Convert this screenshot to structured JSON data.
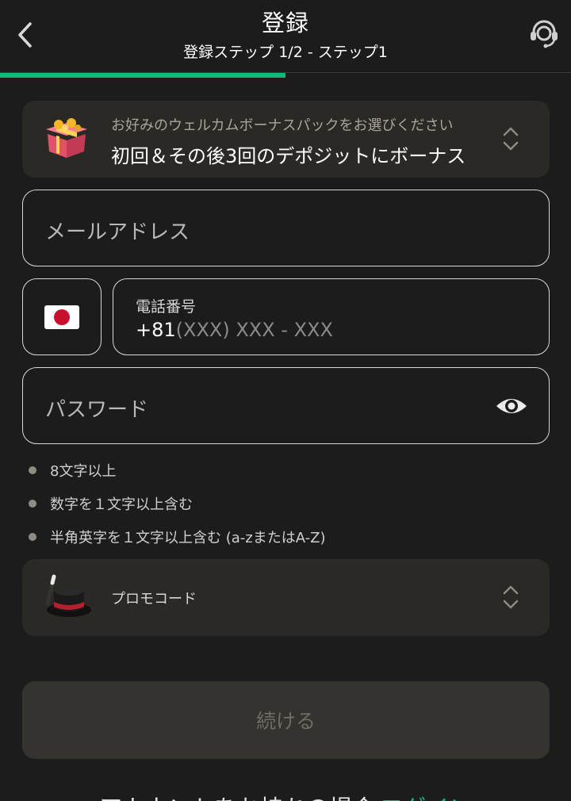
{
  "header": {
    "title": "登録",
    "subtitle": "登録ステップ 1/2 - ステップ1",
    "progress": 0.5
  },
  "bonus": {
    "hint": "お好みのウェルカムボーナスパックをお選びください",
    "value": "初回＆その後3回のデポジットにボーナス"
  },
  "email": {
    "placeholder": "メールアドレス"
  },
  "phone": {
    "country_flag": "jp-flag",
    "label": "電話番号",
    "prefix": "+81",
    "placeholder": "(XXX) XXX - XXX"
  },
  "password": {
    "placeholder": "パスワード"
  },
  "requirements": [
    "8文字以上",
    "数字を１文字以上含む",
    "半角英字を１文字以上含む (a-zまたはA-Z)"
  ],
  "promo": {
    "label": "プロモコード"
  },
  "continue_label": "続ける",
  "footer": {
    "text": "アカウントをお持ちの場合",
    "login": "ログイン"
  },
  "colors": {
    "accent": "#10b97a",
    "background": "#1c1c1c",
    "panel": "#2b2925"
  }
}
